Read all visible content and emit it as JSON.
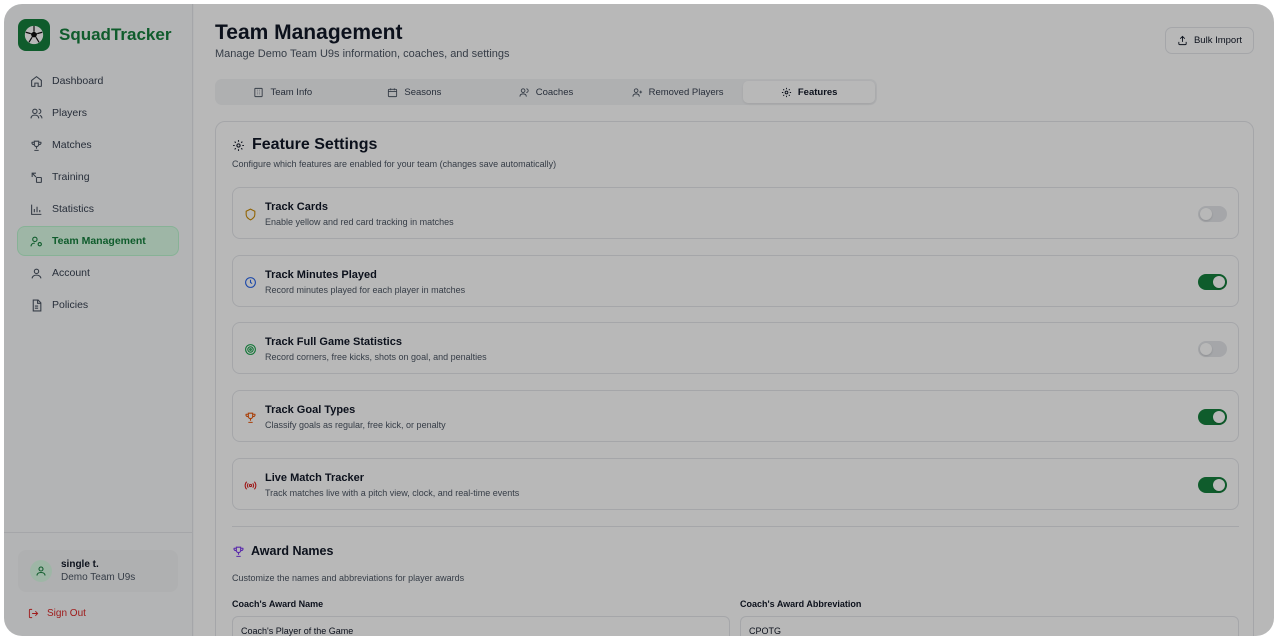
{
  "brand": {
    "name": "SquadTracker"
  },
  "nav": [
    {
      "label": "Dashboard",
      "icon": "home-icon"
    },
    {
      "label": "Players",
      "icon": "users-icon"
    },
    {
      "label": "Matches",
      "icon": "trophy-icon"
    },
    {
      "label": "Training",
      "icon": "training-icon"
    },
    {
      "label": "Statistics",
      "icon": "bar-chart-icon"
    },
    {
      "label": "Team Management",
      "icon": "user-cog-icon",
      "active": true
    },
    {
      "label": "Account",
      "icon": "user-icon"
    },
    {
      "label": "Policies",
      "icon": "document-icon"
    }
  ],
  "user": {
    "name": "single t.",
    "team": "Demo Team U9s"
  },
  "sign_out": "Sign Out",
  "header": {
    "title": "Team Management",
    "subtitle": "Manage Demo Team U9s information, coaches, and settings",
    "bulk_import": "Bulk Import"
  },
  "tabs": [
    {
      "label": "Team Info",
      "icon": "building-icon"
    },
    {
      "label": "Seasons",
      "icon": "calendar-icon"
    },
    {
      "label": "Coaches",
      "icon": "users-icon"
    },
    {
      "label": "Removed Players",
      "icon": "user-plus-icon"
    },
    {
      "label": "Features",
      "icon": "gear-icon",
      "active": true
    }
  ],
  "feature_settings": {
    "title": "Feature Settings",
    "description": "Configure which features are enabled for your team (changes save automatically)",
    "features": [
      {
        "title": "Track Cards",
        "description": "Enable yellow and red card tracking in matches",
        "enabled": false,
        "icon": "shield-icon",
        "icon_color": "#ca8a04"
      },
      {
        "title": "Track Minutes Played",
        "description": "Record minutes played for each player in matches",
        "enabled": true,
        "icon": "clock-icon",
        "icon_color": "#2563eb"
      },
      {
        "title": "Track Full Game Statistics",
        "description": "Record corners, free kicks, shots on goal, and penalties",
        "enabled": false,
        "icon": "target-icon",
        "icon_color": "#16a34a"
      },
      {
        "title": "Track Goal Types",
        "description": "Classify goals as regular, free kick, or penalty",
        "enabled": true,
        "icon": "trophy-icon",
        "icon_color": "#ea580c"
      },
      {
        "title": "Live Match Tracker",
        "description": "Track matches live with a pitch view, clock, and real-time events",
        "enabled": true,
        "icon": "broadcast-icon",
        "icon_color": "#dc2626"
      }
    ]
  },
  "award_names": {
    "title": "Award Names",
    "description": "Customize the names and abbreviations for player awards",
    "coach_award_name_label": "Coach's Award Name",
    "coach_award_name_value": "Coach's Player of the Game",
    "coach_award_abbr_label": "Coach's Award Abbreviation",
    "coach_award_abbr_value": "CPOTG"
  },
  "colors": {
    "brand": "#15803d",
    "active_bg": "#dcfce7",
    "danger": "#dc2626",
    "toggle_on": "#15803d",
    "toggle_off": "#e5e7eb"
  }
}
